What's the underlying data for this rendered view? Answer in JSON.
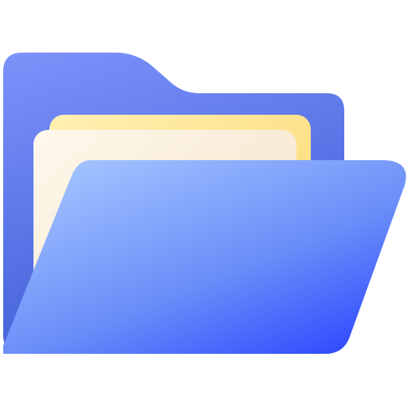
{
  "icon": {
    "name": "open-folder-icon",
    "colors": {
      "back_light": "#7d93fb",
      "back_dark": "#3f5ed6",
      "paper_back_light": "#fff0b3",
      "paper_back_dark": "#fcd56a",
      "paper_front_light": "#fff8ec",
      "paper_front_dark": "#f1dfc4",
      "front_light": "#a3c3ff",
      "front_mid": "#6a8ef8",
      "front_dark": "#2a46ff"
    }
  }
}
